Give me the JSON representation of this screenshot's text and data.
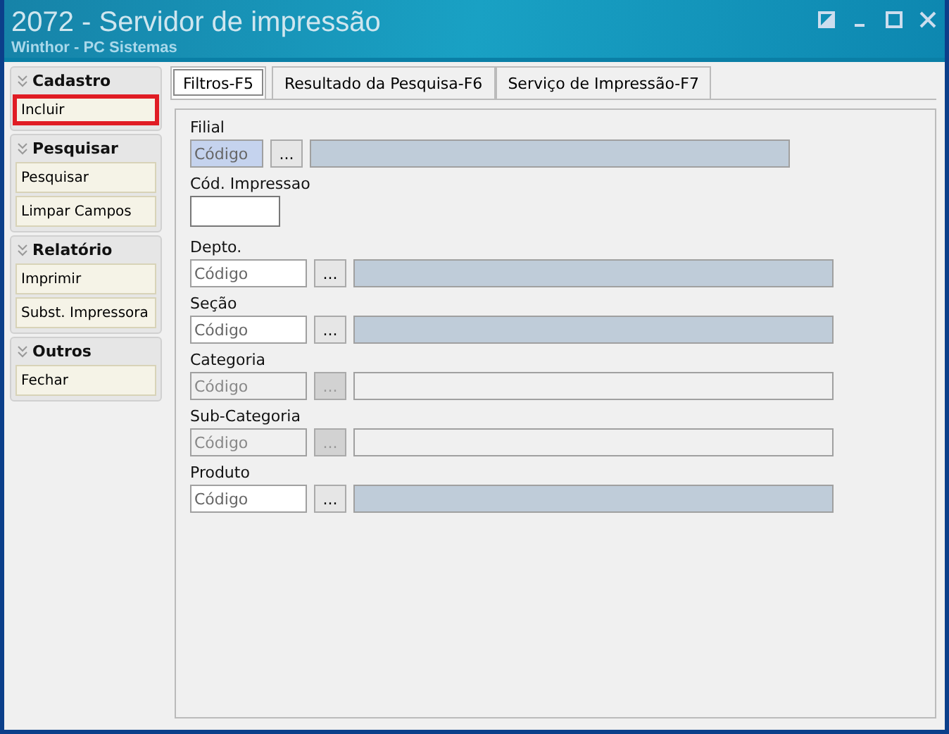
{
  "window": {
    "title": "2072 - Servidor de impressão",
    "subtitle": "Winthor - PC Sistemas"
  },
  "sidebar": {
    "groups": [
      {
        "title": "Cadastro",
        "items": [
          {
            "label": "Incluir",
            "highlighted": true
          }
        ]
      },
      {
        "title": "Pesquisar",
        "items": [
          {
            "label": "Pesquisar",
            "highlighted": false
          },
          {
            "label": "Limpar Campos",
            "highlighted": false
          }
        ]
      },
      {
        "title": "Relatório",
        "items": [
          {
            "label": "Imprimir",
            "highlighted": false
          },
          {
            "label": "Subst. Impressora",
            "highlighted": false
          }
        ]
      },
      {
        "title": "Outros",
        "items": [
          {
            "label": "Fechar",
            "highlighted": false
          }
        ]
      }
    ]
  },
  "tabs": [
    {
      "label": "Filtros-F5",
      "selected": true
    },
    {
      "label": "Resultado da Pesquisa-F6",
      "selected": false
    },
    {
      "label": "Serviço de Impressão-F7",
      "selected": false
    }
  ],
  "filters": [
    {
      "kind": "lookup",
      "label": "Filial",
      "placeholder": "Código",
      "button_label": "...",
      "disabled": false,
      "focused": true
    },
    {
      "kind": "text",
      "label": "Cód. Impressao"
    },
    {
      "kind": "lookup",
      "label": "Depto.",
      "placeholder": "Código",
      "button_label": "...",
      "disabled": false,
      "focused": false
    },
    {
      "kind": "lookup",
      "label": "Seção",
      "placeholder": "Código",
      "button_label": "...",
      "disabled": false,
      "focused": false
    },
    {
      "kind": "lookup",
      "label": "Categoria",
      "placeholder": "Código",
      "button_label": "...",
      "disabled": true,
      "focused": false
    },
    {
      "kind": "lookup",
      "label": "Sub-Categoria",
      "placeholder": "Código",
      "button_label": "...",
      "disabled": true,
      "focused": false
    },
    {
      "kind": "lookup",
      "label": "Produto",
      "placeholder": "Código",
      "button_label": "...",
      "disabled": false,
      "focused": false
    }
  ]
}
